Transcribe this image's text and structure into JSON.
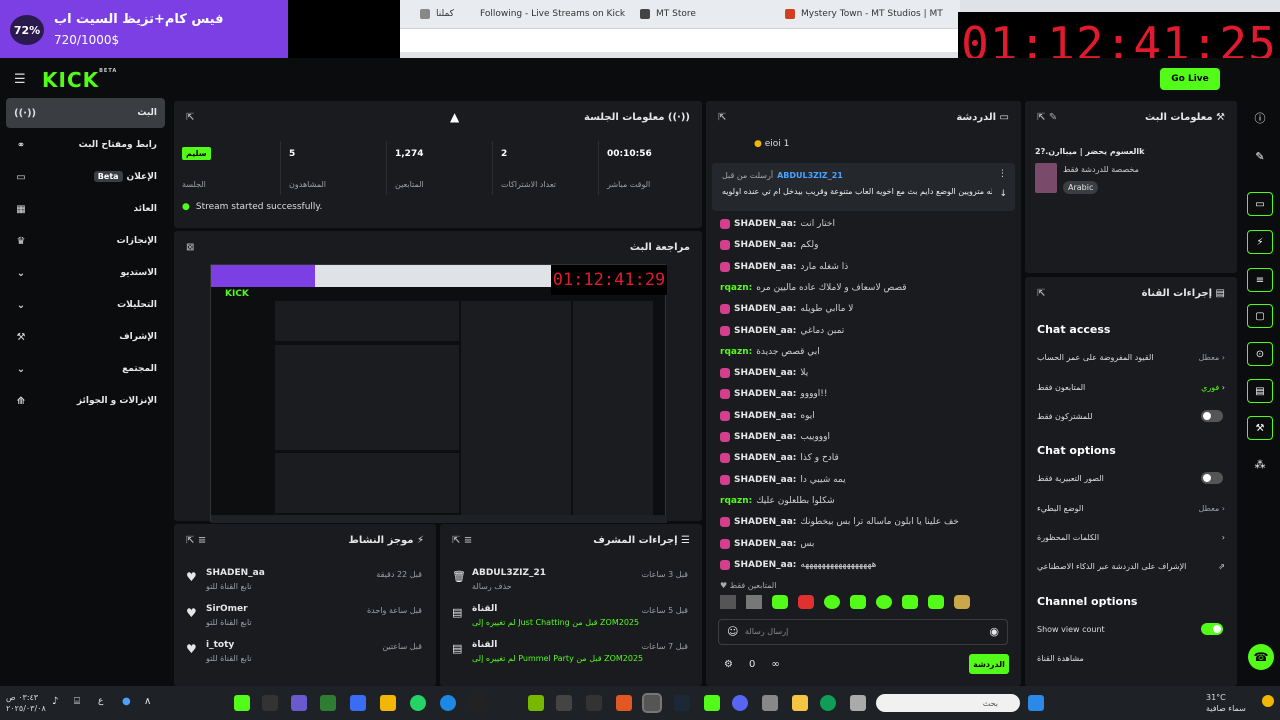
{
  "overlay": {
    "percent": "72%",
    "title": "فيس كام+تزيظ السيت اب",
    "goal": "720/1000$"
  },
  "timer": "01:12:41:25",
  "browser_tabs": [
    {
      "label": "كملنا",
      "color": "#888"
    },
    {
      "label": "Following - Live Streams on Kick",
      "color": "#53fc18"
    },
    {
      "label": "MT Store",
      "color": "#444"
    },
    {
      "label": "Mystery Town - MT Studios | MT",
      "color": "#d04020"
    }
  ],
  "header": {
    "logo": "KICK",
    "logo_sup": "BETA",
    "go_live": "Go Live"
  },
  "sidebar": {
    "items": [
      {
        "label": "البث",
        "icon": "((·))",
        "active": true
      },
      {
        "label": "رابط ومفتاح البث",
        "icon": "⚭"
      },
      {
        "label": "الإعلان",
        "icon": "▭",
        "badge": "Beta"
      },
      {
        "label": "العائد",
        "icon": "▦"
      },
      {
        "label": "الإنجازات",
        "icon": "♛"
      },
      {
        "label": "الاستديو",
        "icon": "▣",
        "caret": "⌄"
      },
      {
        "label": "التحليلات",
        "icon": "⇗",
        "caret": "⌄"
      },
      {
        "label": "الإشراف",
        "icon": "⚒"
      },
      {
        "label": "المجتمع",
        "icon": "⚉",
        "caret": "⌄"
      },
      {
        "label": "الإنزالات و الجوائز",
        "icon": "⟰"
      }
    ]
  },
  "session": {
    "title": "معلومات الجلسة",
    "badge": "سليم",
    "session_label": "الجلسة",
    "stats": [
      {
        "value": "5",
        "label": "المشاهدون"
      },
      {
        "value": "1,274",
        "label": "المتابعين"
      },
      {
        "value": "2",
        "label": "تعداد الاشتراكات"
      },
      {
        "value": "00:10:56",
        "label": "الوقت مباشر"
      }
    ],
    "status": "Stream started successfully."
  },
  "review": {
    "title": "مراجعة البث",
    "preview_timer": "01:12:41:29"
  },
  "activity": {
    "title": "موجز النشاط",
    "items": [
      {
        "user": "SHADEN_aa",
        "sub": "تابع القناة للتو",
        "time": "قبل 22 دقيقة"
      },
      {
        "user": "SirOmer",
        "sub": "تابع القناة للتو",
        "time": "قبل ساعة واحدة"
      },
      {
        "user": "i_toty",
        "sub": "تابع القناة للتو",
        "time": "قبل ساعتين"
      }
    ]
  },
  "modactions": {
    "title": "إجراءات المشرف",
    "items": [
      {
        "user": "ABDUL3ZIZ_21",
        "sub": "حذف رسالة",
        "time": "قبل 3 ساعات"
      },
      {
        "user": "القناة",
        "sub": "لم تغييره إلى Just Chatting قبل من ZOM2025",
        "time": "قبل 5 ساعات"
      },
      {
        "user": "القناة",
        "sub": "لم تغييره إلى Pummel Party قبل من ZOM2025",
        "time": "قبل 7 ساعات"
      }
    ]
  },
  "chat": {
    "title": "الدردشة",
    "pinned_top": "eioi 1",
    "pinned_by": "ABDUL3ZIZ_21",
    "pinned_by_label": "أرسلت من قبل",
    "pinned_text": "والله مترويين الوضع دايم بث مع اخويه العاب متنوعة وقريب بيدخل ام تي عنده اولويه",
    "messages": [
      {
        "user": "SHADEN_aa:",
        "text": "اختار انت",
        "green": false
      },
      {
        "user": "SHADEN_aa:",
        "text": "ولكم",
        "green": false
      },
      {
        "user": "SHADEN_aa:",
        "text": "ذا شغله مارد",
        "green": false
      },
      {
        "user": "rqazn:",
        "text": "قصص لاسعاف و لاملاك عاده ماليين مره",
        "green": true
      },
      {
        "user": "SHADEN_aa:",
        "text": "لا ماابي طويله",
        "green": false
      },
      {
        "user": "SHADEN_aa:",
        "text": "تمبن دماغي",
        "green": false
      },
      {
        "user": "rqazn:",
        "text": "ابي قصص جديدة",
        "green": true
      },
      {
        "user": "SHADEN_aa:",
        "text": "يلا",
        "green": false
      },
      {
        "user": "SHADEN_aa:",
        "text": "اوووو!!",
        "green": false
      },
      {
        "user": "SHADEN_aa:",
        "text": "ايوه",
        "green": false
      },
      {
        "user": "SHADEN_aa:",
        "text": "اوووييب",
        "green": false
      },
      {
        "user": "SHADEN_aa:",
        "text": "قادح و كذا",
        "green": false
      },
      {
        "user": "SHADEN_aa:",
        "text": "يمه شيبي دا",
        "green": false
      },
      {
        "user": "rqazn:",
        "text": "شكلوا بطلعلون عليك",
        "green": true
      },
      {
        "user": "SHADEN_aa:",
        "text": "خف علينا يا ابلون ماساله ترا بس بيخطونك",
        "green": false
      },
      {
        "user": "SHADEN_aa:",
        "text": "بس",
        "green": false
      },
      {
        "user": "SHADEN_aa:",
        "text": "هههههههههههههههههه",
        "green": false
      }
    ],
    "followers_only": "المتابعين فقط",
    "input_placeholder": "إرسال رسالة",
    "send": "الدردشة",
    "count": "0"
  },
  "streaminfo": {
    "title": "معلومات البث",
    "stream_title": "العسوم يحضر | ميباارن.?2k",
    "category": "مخصصة للدردشة فقط",
    "language": "Arabic"
  },
  "channel": {
    "title": "إجراءات القناة",
    "chat_access": "Chat access",
    "access_rows": [
      {
        "label": "القيود المفروضة على عمر الحساب",
        "value": "معطل"
      },
      {
        "label": "المتابعون فقط",
        "value": "فوري"
      },
      {
        "label": "للمشتركون فقط",
        "value": ""
      }
    ],
    "chat_options": "Chat options",
    "option_rows": [
      {
        "label": "الصور التعبيرية فقط",
        "value": ""
      },
      {
        "label": "الوضع البطيء",
        "value": "معطل"
      },
      {
        "label": "الكلمات المحظورة",
        "value": ""
      },
      {
        "label": "الإشراف على الدردشة عبر الذكاء الاصطناعي",
        "value": ""
      }
    ],
    "channel_options": "Channel options",
    "show_view_count": "Show view count",
    "watch_channel": "مشاهدة القناة"
  },
  "taskbar": {
    "search": "بحث",
    "weather": "31°C",
    "weather_sub": "سماء صافية",
    "time": "٠٣:٤٣ ص",
    "date": "٢٠٢٥/٠٣/٠٨",
    "lang": "ع"
  }
}
